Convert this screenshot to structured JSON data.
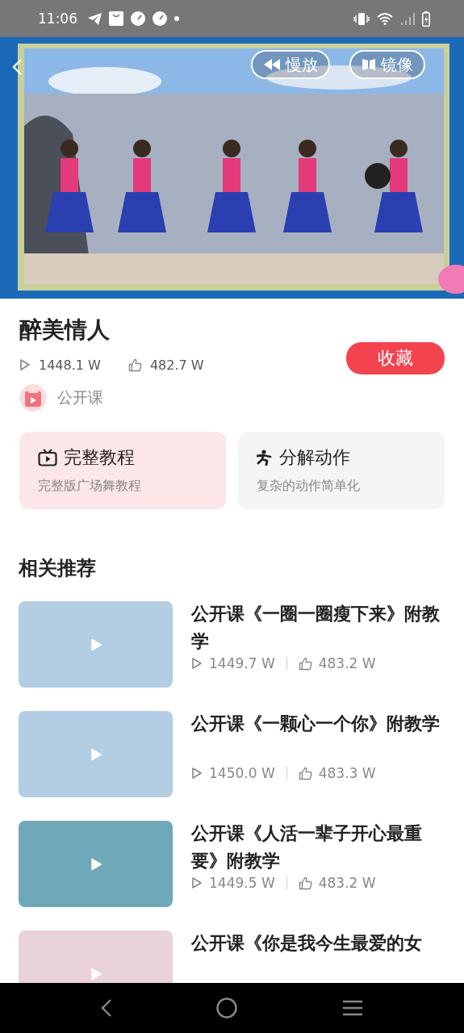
{
  "status_bar": {
    "time": "11:06"
  },
  "player": {
    "buttons": [
      {
        "label": "慢放",
        "kind": "slow"
      },
      {
        "label": "镜像",
        "kind": "mirror"
      }
    ]
  },
  "video": {
    "title": "醉美情人",
    "plays": "1448.1 W",
    "likes": "482.7 W",
    "favorite_button": "收藏",
    "channel": "公开课"
  },
  "features": [
    {
      "title": "完整教程",
      "subtitle": "完整版广场舞教程",
      "kind": "tutorial"
    },
    {
      "title": "分解动作",
      "subtitle": "复杂的动作简单化",
      "kind": "breakdown"
    }
  ],
  "related": {
    "heading": "相关推荐",
    "items": [
      {
        "title": "公开课《一圈一圈瘦下来》附教学",
        "plays": "1449.7 W",
        "likes": "483.2 W",
        "color": "#b3cde3"
      },
      {
        "title": "公开课《一颗心一个你》附教学",
        "plays": "1450.0 W",
        "likes": "483.3 W",
        "color": "#b3cde3"
      },
      {
        "title": "公开课《人活一辈子开心最重要》附教学",
        "plays": "1449.5 W",
        "likes": "483.2 W",
        "color": "#6fa8b9"
      },
      {
        "title": "公开课《你是我今生最爱的女",
        "color": "#ead3d8"
      }
    ]
  }
}
